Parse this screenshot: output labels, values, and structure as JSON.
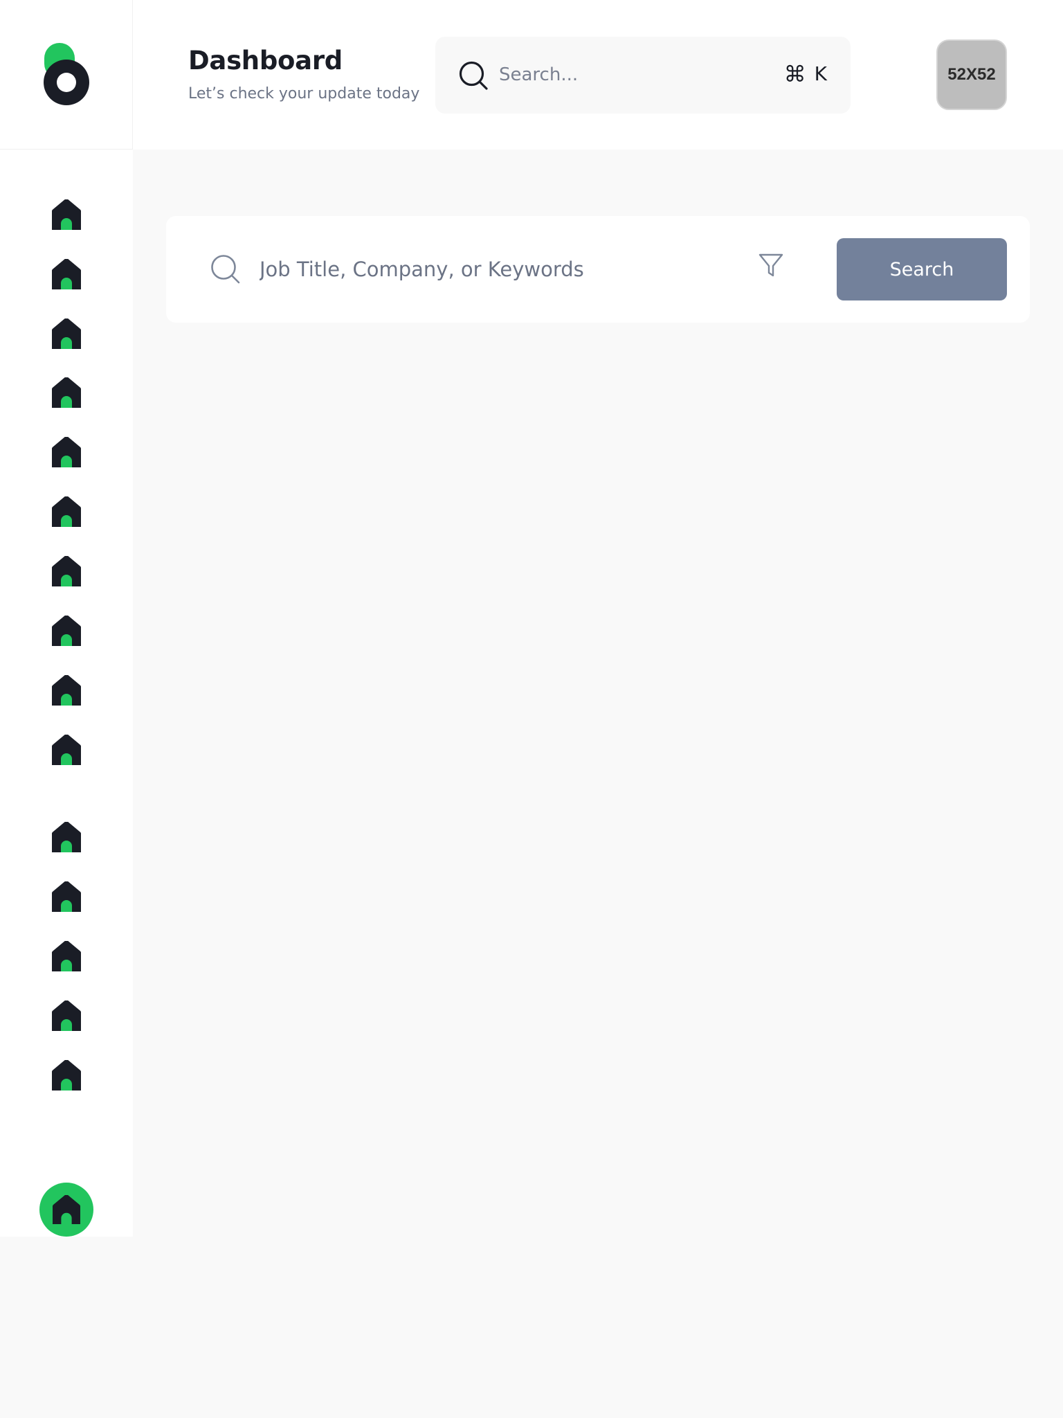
{
  "header": {
    "title": "Dashboard",
    "subtitle": "Let’s check your update today",
    "search": {
      "placeholder": "Search...",
      "shortcut_symbol": "⌘",
      "shortcut_key": "K",
      "icon": "search-icon"
    },
    "avatar": {
      "label": "52X52"
    }
  },
  "sidebar": {
    "logo": "brand-logo",
    "items": [
      {
        "icon": "home-icon"
      },
      {
        "icon": "home-icon"
      },
      {
        "icon": "home-icon"
      },
      {
        "icon": "home-icon"
      },
      {
        "icon": "home-icon"
      },
      {
        "icon": "home-icon"
      },
      {
        "icon": "home-icon"
      },
      {
        "icon": "home-icon"
      },
      {
        "icon": "home-icon"
      },
      {
        "icon": "home-icon"
      },
      {
        "icon": "home-icon"
      },
      {
        "icon": "home-icon"
      },
      {
        "icon": "home-icon"
      },
      {
        "icon": "home-icon"
      },
      {
        "icon": "home-icon"
      }
    ],
    "active_item": {
      "icon": "home-icon"
    }
  },
  "job_search": {
    "placeholder": "Job Title, Company, or Keywords",
    "search_icon": "search-icon",
    "filter_icon": "filter-icon",
    "button_label": "Search"
  },
  "colors": {
    "accent": "#22c55e",
    "dark": "#1a1d26",
    "button": "#73819b",
    "background": "#f9f9f9"
  }
}
